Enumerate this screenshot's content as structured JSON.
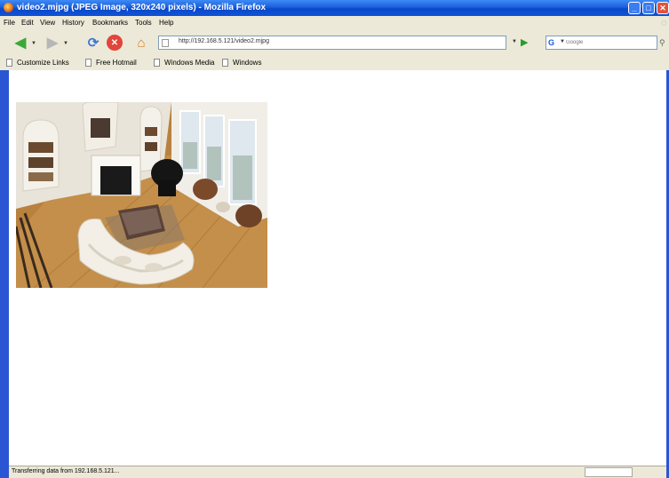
{
  "window": {
    "title": "video2.mjpg (JPEG Image, 320x240 pixels) - Mozilla Firefox",
    "minimize_glyph": "_",
    "maximize_glyph": "□",
    "close_glyph": "✕"
  },
  "menu": {
    "items": [
      "File",
      "Edit",
      "View",
      "History",
      "Bookmarks",
      "Tools",
      "Help"
    ]
  },
  "toolbar": {
    "back_icon": "back-arrow-icon",
    "forward_icon": "forward-arrow-icon",
    "reload_icon": "reload-icon",
    "stop_icon": "stop-icon",
    "home_icon": "home-icon",
    "url": "http://192.168.5.121/video2.mjpg",
    "search_placeholder": "Google"
  },
  "bookmarks": {
    "items": [
      "Customize Links",
      "Free Hotmail",
      "Windows Media",
      "Windows"
    ]
  },
  "content": {
    "image_subject": "living room with fireplace, white sofa and ottoman"
  },
  "status": {
    "text": "Transferring data from 192.168.5.121..."
  },
  "colors": {
    "titlebar": "#0a48c9",
    "chrome": "#ece9d8",
    "frame": "#2a56d4"
  }
}
